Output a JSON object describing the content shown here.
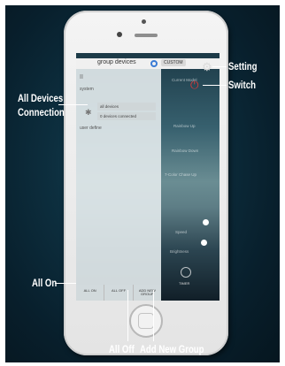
{
  "app": {
    "top_bar_title": "group devices",
    "custom_tab": "CUSTOM"
  },
  "drawer": {
    "pause_glyph": "II",
    "system_label": "system",
    "connections": [
      "all devices",
      "0 devices connected"
    ],
    "user_define_label": "user define",
    "background_labels": [
      "Current Model",
      "Rainbow Up",
      "Rainbow Down",
      "7-Color Chase Up",
      "Speed",
      "Brightness"
    ]
  },
  "bottom_bar": {
    "all_on": "ALL ON",
    "all_off": "ALL OFF",
    "add_new_group": "ADD NEW GROUP"
  },
  "timer_label": "TIMER",
  "icons": {
    "settings": "gear-icon",
    "switch": "power-icon",
    "bluetooth": "bluetooth-icon",
    "timer": "timer-icon"
  },
  "colors": {
    "power_red": "#d63a3a",
    "accent_blue": "#3a7bd5"
  },
  "callouts": {
    "setting": "Setting",
    "switch": "Switch",
    "all_devices_connection": [
      "All Devices",
      "Connection"
    ],
    "all_on": "All On",
    "all_off": "All Off",
    "add_new_group": "Add New Group"
  }
}
